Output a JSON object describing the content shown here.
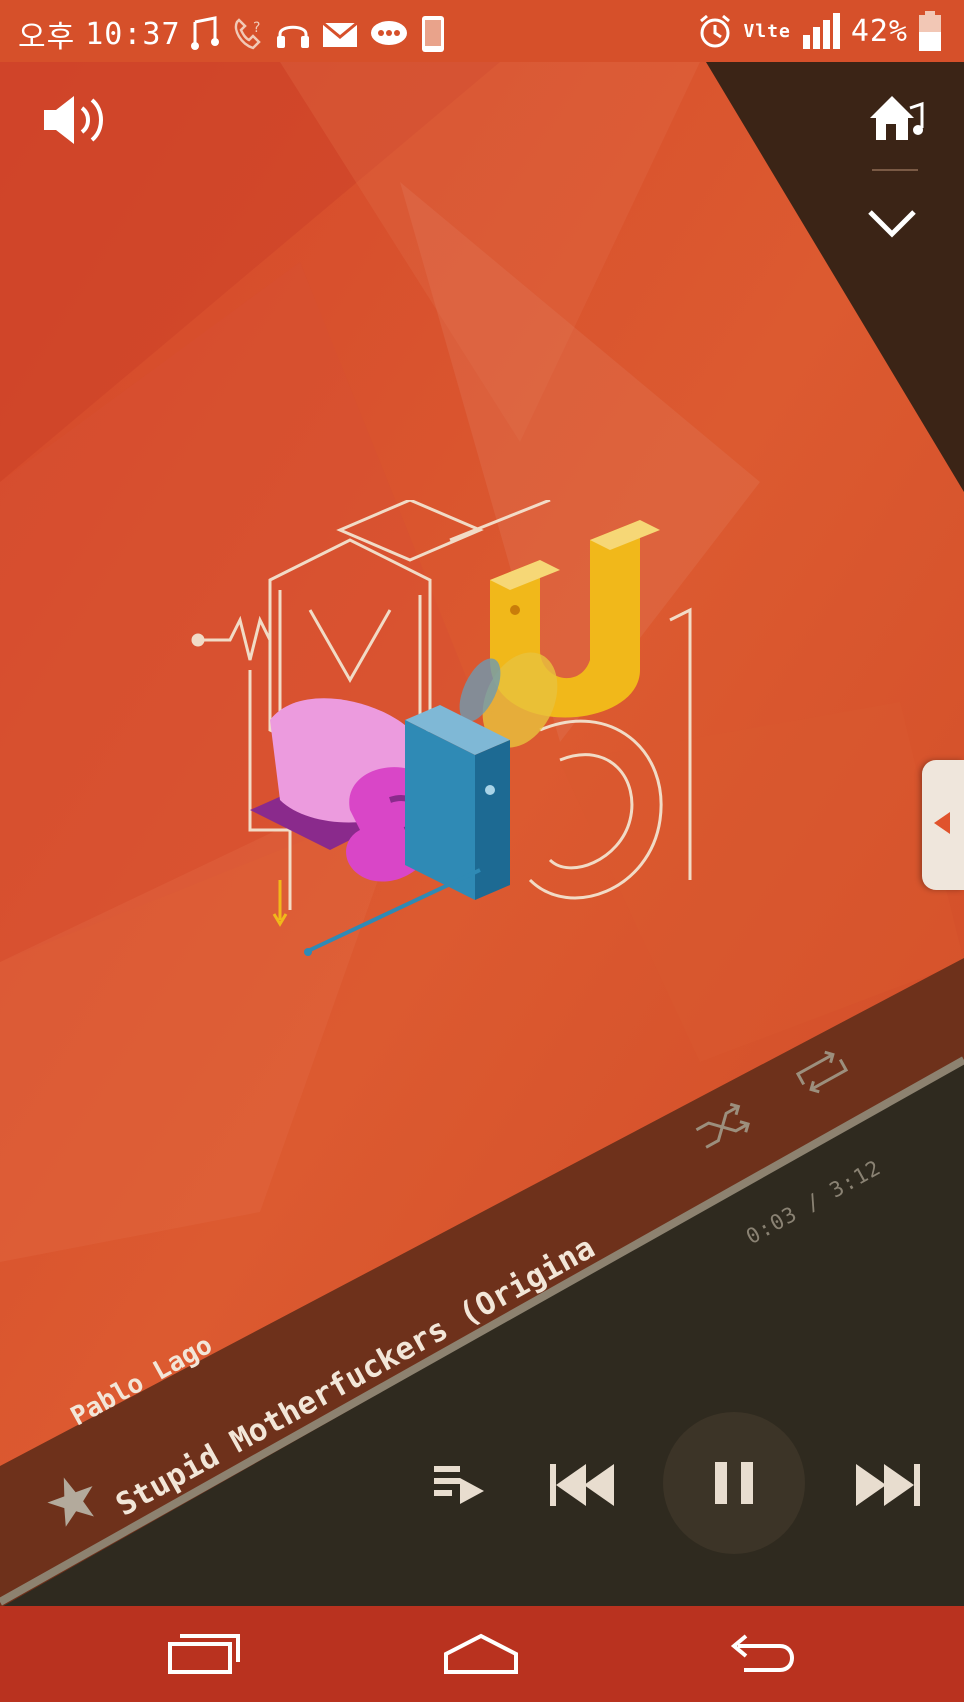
{
  "status_bar": {
    "carrier_text": "오후",
    "time": "10:37",
    "network": "lte",
    "battery": "42%",
    "icons": [
      "music-note-icon",
      "phone-missed-icon",
      "headset-icon",
      "mail-icon",
      "chat-icon",
      "phone-device-icon",
      "alarm-icon",
      "volte-icon",
      "signal-icon",
      "battery-icon"
    ]
  },
  "player": {
    "artist": "Pablo Lago",
    "title": "Stupid Motherfuckers (Origina",
    "elapsed": "0:03",
    "separator": "/",
    "duration": "3:12",
    "favorite": true,
    "state": "playing",
    "buttons": [
      "volume-icon",
      "home-music-icon",
      "collapse-chevron-icon",
      "shuffle-icon",
      "repeat-icon",
      "playlist-icon",
      "previous-icon",
      "pause-icon",
      "next-icon"
    ]
  },
  "album_art": {
    "letters": [
      "M",
      "U",
      "S",
      "I",
      "C"
    ],
    "colors": {
      "bg": "#d9512c",
      "yellow": "#f1b81a",
      "pink": "#e05bd2",
      "blue": "#2f8ab5",
      "outline": "#f3e3cf"
    }
  },
  "nav_bar": {
    "icons": [
      "recent-apps-icon",
      "home-icon",
      "back-icon"
    ]
  },
  "colors": {
    "accent": "#d6502a",
    "panel_dark": "#2f2a1f",
    "panel_brown": "#6e311b",
    "nav": "#b9321f"
  }
}
